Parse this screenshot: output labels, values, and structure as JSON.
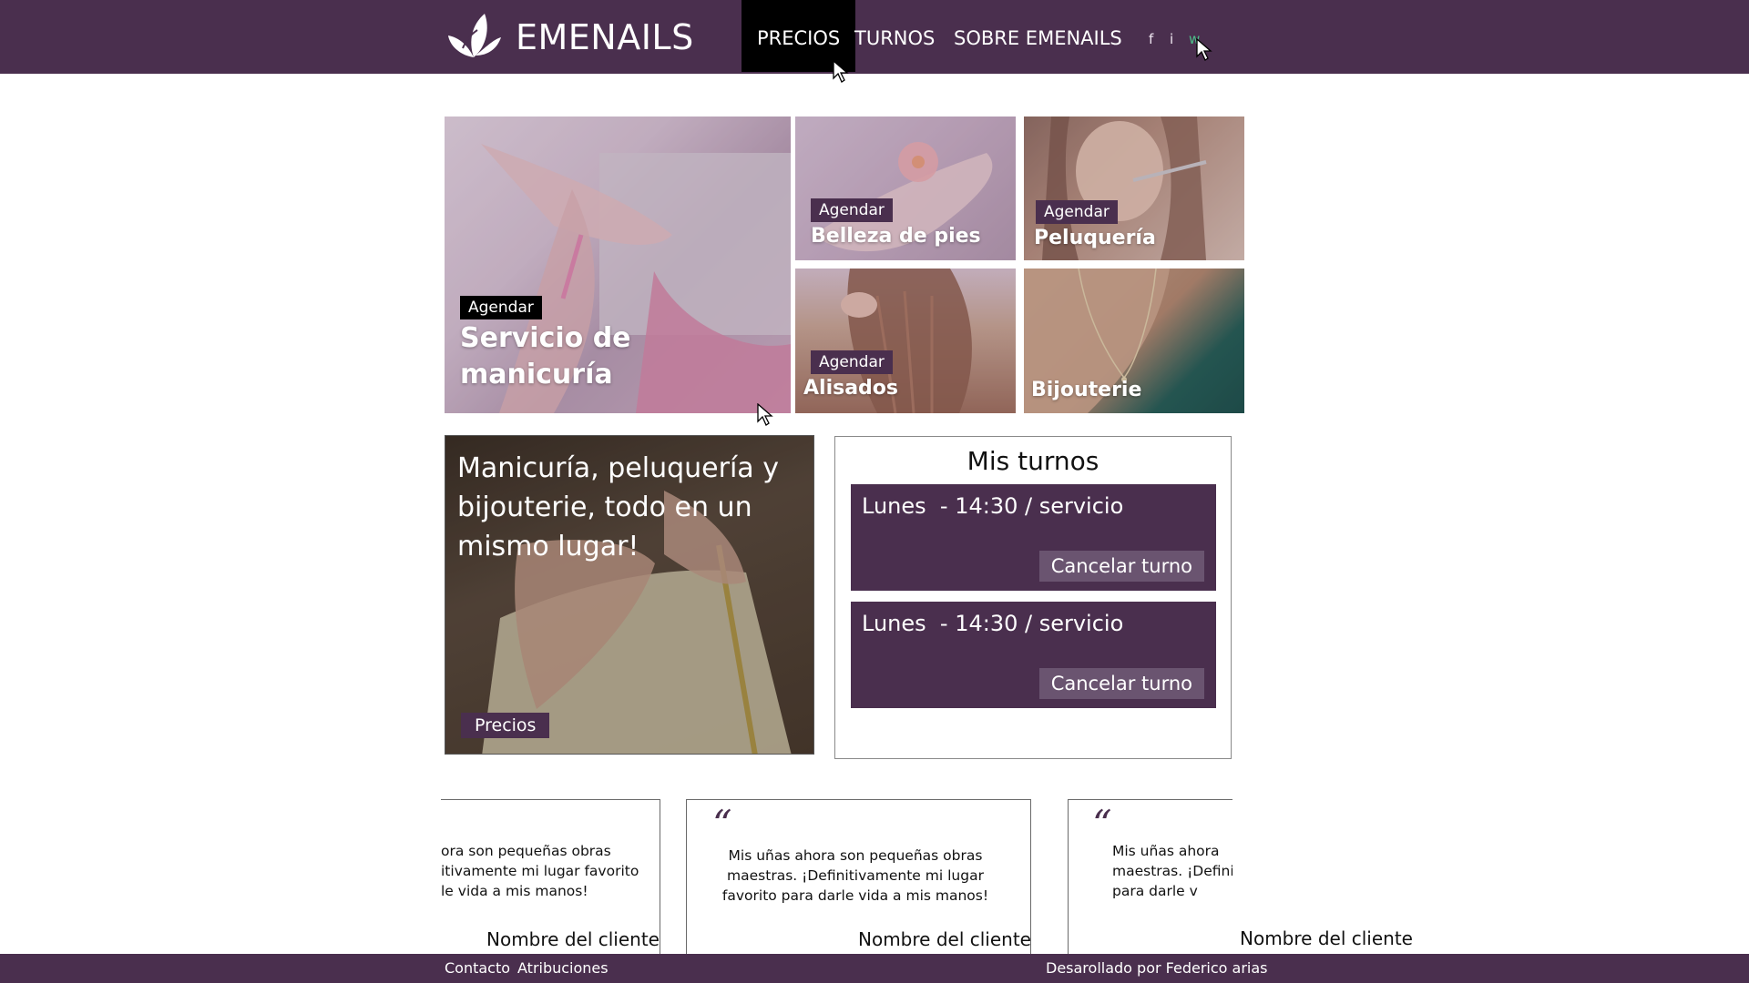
{
  "brand": {
    "name": "EMENAILS",
    "logo_icon": "leaf-butterfly-logo"
  },
  "nav": {
    "items": [
      {
        "label": "PRECIOS",
        "active": true
      },
      {
        "label": "TURNOS",
        "active": false
      },
      {
        "label": "SOBRE EMENAILS",
        "active": false
      }
    ],
    "social": [
      {
        "label": "f",
        "icon": "facebook-icon"
      },
      {
        "label": "i",
        "icon": "instagram-icon"
      },
      {
        "label": "w",
        "icon": "whatsapp-icon"
      }
    ]
  },
  "services": {
    "manicura": {
      "tag": "Agendar",
      "title": "Servicio de manicuría"
    },
    "pies": {
      "tag": "Agendar",
      "title": "Belleza de pies"
    },
    "peluqueria": {
      "tag": "Agendar",
      "title": "Peluquería"
    },
    "alisados": {
      "tag": "Agendar",
      "title": "Alisados"
    },
    "bijouterie": {
      "title": "Bijouterie"
    }
  },
  "promo": {
    "text": "Manicuría, peluquería y bijouterie, todo en un mismo lugar!",
    "button": "Precios"
  },
  "turnos": {
    "title": "Mis turnos",
    "items": [
      {
        "text": "Lunes  - 14:30 / servicio",
        "cancel": "Cancelar turno"
      },
      {
        "text": "Lunes  - 14:30 / servicio",
        "cancel": "Cancelar turno"
      }
    ]
  },
  "reviews": {
    "left_text": "ora son pequeñas obras\nitivamente mi lugar favorito\nle vida a mis manos!",
    "center_text": "Mis uñas ahora son pequeñas obras maestras. ¡Definitivamente mi lugar favorito para darle vida a mis manos!",
    "right_text": "Mis uñas ahora\nmaestras. ¡Definiti\npara darle v",
    "quote": "“",
    "name": "Nombre del cliente"
  },
  "footer": {
    "contacto": "Contacto",
    "atribuciones": "Atribuciones",
    "credits": "Desarollado por Federico arias"
  },
  "colors": {
    "brand": "#4a2f4e",
    "active_nav": "#000000",
    "whatsapp": "#4cc08a"
  }
}
